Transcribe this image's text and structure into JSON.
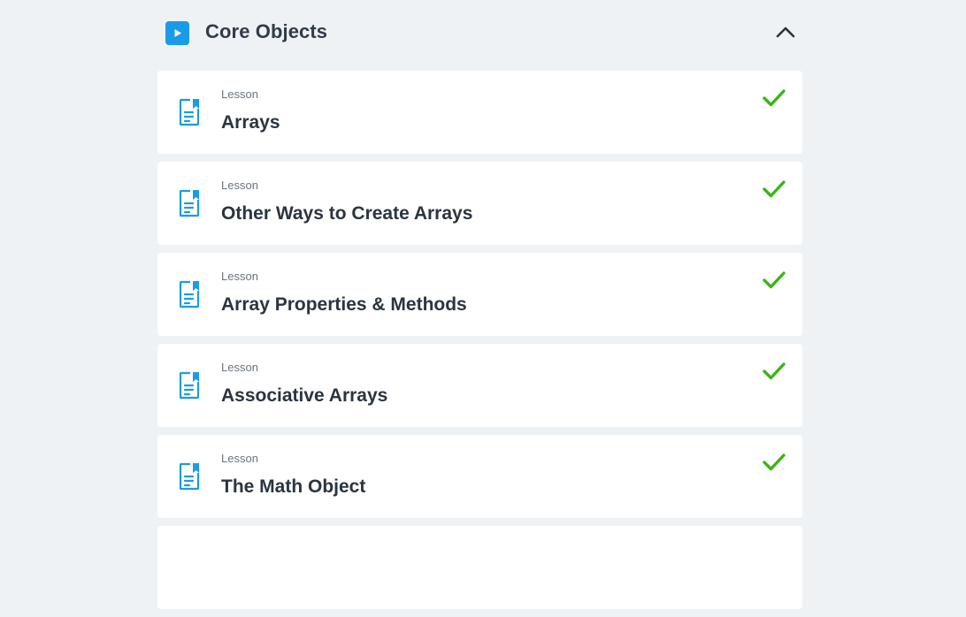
{
  "section": {
    "title": "Core Objects",
    "badge_icon": "play-icon",
    "toggle_icon": "chevron-up-icon",
    "expanded": true
  },
  "colors": {
    "background": "#eff2f5",
    "accent": "#1a9be8",
    "complete": "#3cb417",
    "text": "#2b3440",
    "muted": "#6b7480"
  },
  "lessons": [
    {
      "type": "Lesson",
      "title": "Arrays",
      "icon": "document-icon",
      "status_icon": "checkmark-icon",
      "completed": true
    },
    {
      "type": "Lesson",
      "title": "Other Ways to Create Arrays",
      "icon": "document-icon",
      "status_icon": "checkmark-icon",
      "completed": true
    },
    {
      "type": "Lesson",
      "title": "Array Properties & Methods",
      "icon": "document-icon",
      "status_icon": "checkmark-icon",
      "completed": true
    },
    {
      "type": "Lesson",
      "title": "Associative Arrays",
      "icon": "document-icon",
      "status_icon": "checkmark-icon",
      "completed": true
    },
    {
      "type": "Lesson",
      "title": "The Math Object",
      "icon": "document-icon",
      "status_icon": "checkmark-icon",
      "completed": true
    },
    {
      "type": "",
      "title": "",
      "icon": "",
      "status_icon": "",
      "completed": false
    }
  ]
}
